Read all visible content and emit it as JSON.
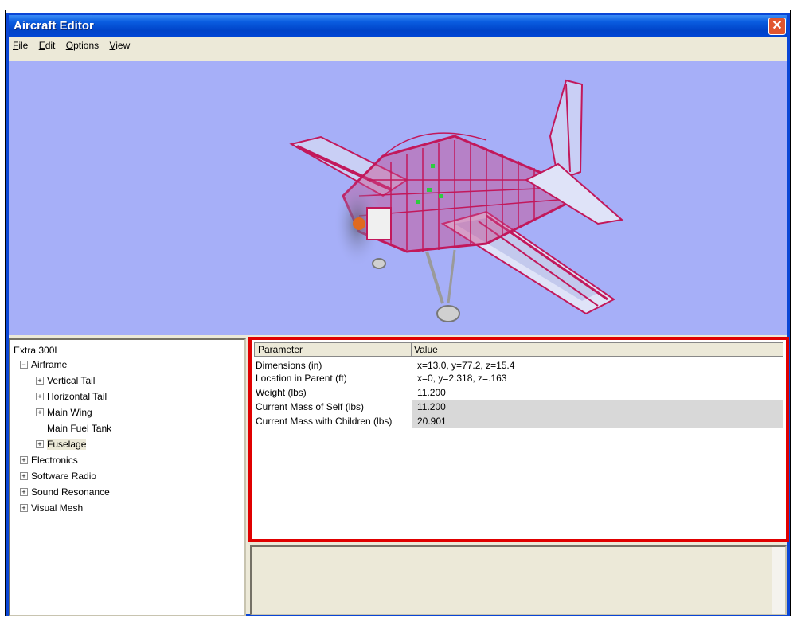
{
  "window": {
    "title": "Aircraft Editor",
    "close_glyph": "✕"
  },
  "menu": [
    {
      "mnemonic": "F",
      "rest": "ile"
    },
    {
      "mnemonic": "E",
      "rest": "dit"
    },
    {
      "mnemonic": "O",
      "rest": "ptions"
    },
    {
      "mnemonic": "V",
      "rest": "iew"
    }
  ],
  "viewport": {
    "background": "#a6aff8",
    "model_color": "#c2185b"
  },
  "tree": {
    "root": "Extra 300L",
    "items": [
      {
        "label": "Airframe",
        "expander": "−"
      },
      {
        "label": "Vertical Tail",
        "expander": "+"
      },
      {
        "label": "Horizontal Tail",
        "expander": "+"
      },
      {
        "label": "Main Wing",
        "expander": "+"
      },
      {
        "label": "Main Fuel Tank",
        "expander": ""
      },
      {
        "label": "Fuselage",
        "expander": "+"
      },
      {
        "label": "Electronics",
        "expander": "+"
      },
      {
        "label": "Software Radio",
        "expander": "+"
      },
      {
        "label": "Sound Resonance",
        "expander": "+"
      },
      {
        "label": "Visual Mesh",
        "expander": "+"
      }
    ]
  },
  "properties": {
    "columns": [
      "Parameter",
      "Value"
    ],
    "rows": [
      {
        "param": "Dimensions (in)",
        "value": "x=13.0, y=77.2, z=15.4"
      },
      {
        "param": "Location in Parent (ft)",
        "value": "x=0, y=2.318, z=.163"
      },
      {
        "param": "Weight (lbs)",
        "value": "11.200"
      },
      {
        "param": "Current Mass of Self (lbs)",
        "value": "11.200"
      },
      {
        "param": "Current Mass with Children (lbs)",
        "value": "20.901"
      }
    ],
    "highlight_color": "#e00000"
  }
}
